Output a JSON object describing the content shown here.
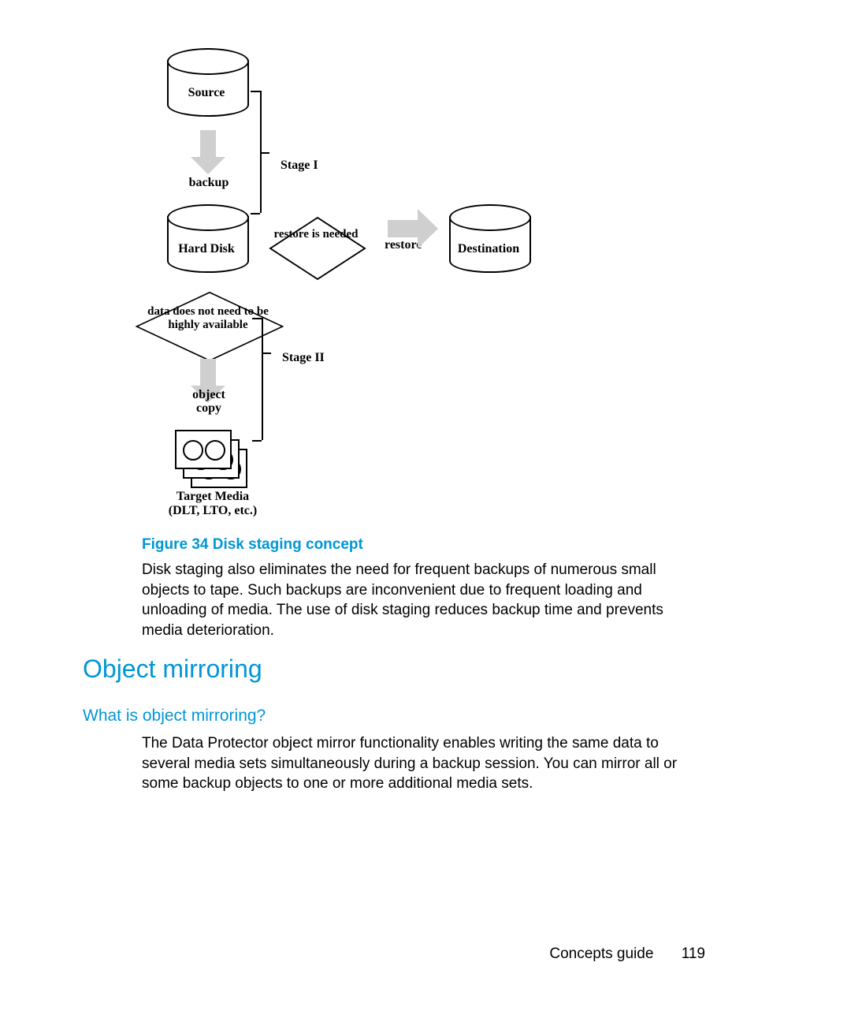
{
  "diagram": {
    "source": "Source",
    "backup": "backup",
    "stage1": "Stage I",
    "hard_disk": "Hard Disk",
    "restore_needed": "restore is needed",
    "restore": "restore",
    "destination": "Destination",
    "data_not_highly": "data does not need to be highly available",
    "stage2": "Stage II",
    "object_copy": "object copy",
    "target_media1": "Target Media",
    "target_media2": "(DLT, LTO, etc.)"
  },
  "figure_caption": "Figure 34 Disk staging concept",
  "paragraphs": {
    "p1": "Disk staging also eliminates the need for frequent backups of numerous small objects to tape. Such backups are inconvenient due to frequent loading and unloading of media. The use of disk staging reduces backup time and prevents media deterioration.",
    "p2": "The Data Protector object mirror functionality enables writing the same data to several media sets simultaneously during a backup session. You can mirror all or some backup objects to one or more additional media sets."
  },
  "headings": {
    "h1": "Object mirroring",
    "h2": "What is object mirroring?"
  },
  "footer": {
    "title": "Concepts guide",
    "page": "119"
  }
}
